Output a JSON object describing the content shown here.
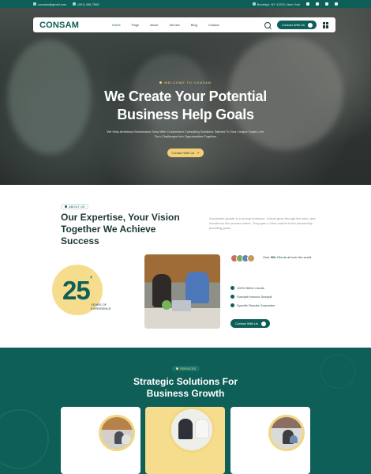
{
  "topbar": {
    "email": "consam@gmail.com",
    "phone": "(001) 456-7890",
    "location": "Brooklyn, NY 11222, New York"
  },
  "nav": {
    "logo": "CONSAM",
    "items": [
      "Home",
      "Page",
      "About",
      "Service",
      "Blog",
      "Contact"
    ],
    "cta": "Contact With Us"
  },
  "hero": {
    "eyebrow": "WELCOME TO CONSAM",
    "title_line1": "We Create Your Potential",
    "title_line2": "Business Help Goals",
    "subtitle": "We Help Ambitious Businesses Grow With Customized Consulting Solutions Tailored To Your Unique Goals Let's Turn Challenges Into Opportunities Together",
    "button": "Contact With Us"
  },
  "about": {
    "label": "ABOUT US",
    "title": "Our Expertise, Your Vision Together We Achieve Success",
    "text": "Successful growth is a mutual endeavor. It must grow through the mind, and transforms the process where. They gain a clear market in the partnership providing goals.",
    "years": "25",
    "years_suffix": "+",
    "years_label": "YEARS OF EXPERIENCE",
    "clients_prefix": "Over",
    "clients_count": "90k",
    "clients_suffix": "Clients all over the world",
    "checks": [
      "100% Better results",
      "Suscipit rhoncus Suscipit",
      "Specific Results Guarantee"
    ],
    "button": "Contact With Us"
  },
  "services": {
    "label": "SERVICES",
    "title_line1": "Strategic Solutions For",
    "title_line2": "Business Growth"
  },
  "colors": {
    "primary": "#0e5f58",
    "accent": "#f4cf77",
    "text": "#1f3b3a"
  }
}
